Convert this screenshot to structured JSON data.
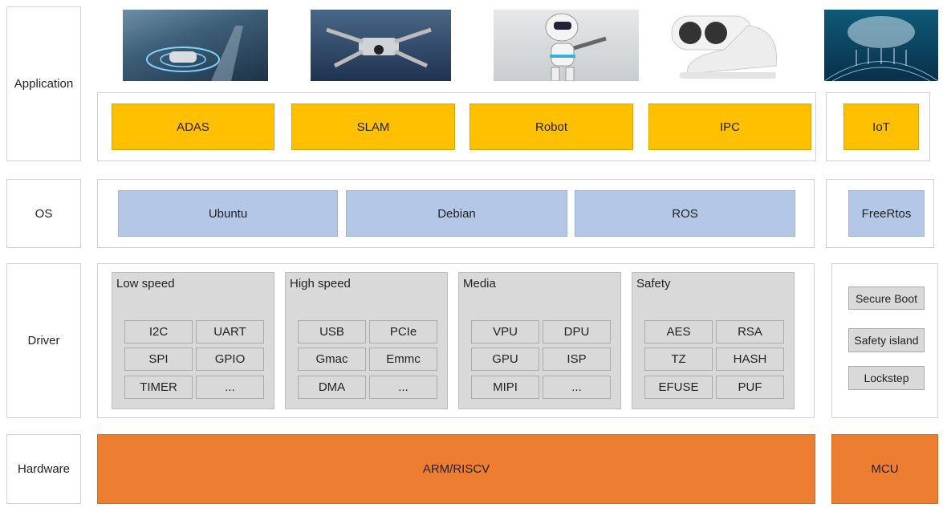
{
  "layers": {
    "application": "Application",
    "os": "OS",
    "driver": "Driver",
    "hardware": "Hardware"
  },
  "application": {
    "images": [
      "adas-car-image",
      "drone-image",
      "robot-image",
      "camera-image",
      "iot-cloud-image"
    ],
    "items": [
      "ADAS",
      "SLAM",
      "Robot",
      "IPC"
    ],
    "iot": "IoT"
  },
  "os": {
    "items": [
      "Ubuntu",
      "Debian",
      "ROS"
    ],
    "rtos": "FreeRtos"
  },
  "driver": {
    "groups": [
      {
        "title": "Low speed",
        "cells": [
          "I2C",
          "UART",
          "SPI",
          "GPIO",
          "TIMER",
          "..."
        ]
      },
      {
        "title": "High speed",
        "cells": [
          "USB",
          "PCIe",
          "Gmac",
          "Emmc",
          "DMA",
          "..."
        ]
      },
      {
        "title": "Media",
        "cells": [
          "VPU",
          "DPU",
          "GPU",
          "ISP",
          "MIPI",
          "..."
        ]
      },
      {
        "title": "Safety",
        "cells": [
          "AES",
          "RSA",
          "TZ",
          "HASH",
          "EFUSE",
          "PUF"
        ]
      }
    ],
    "mcu_items": [
      "Secure Boot",
      "Safety island",
      "Lockstep"
    ]
  },
  "hardware": {
    "main": "ARM/RISCV",
    "mcu": "MCU"
  },
  "colors": {
    "application": "#ffc000",
    "os": "#b4c7e7",
    "driver": "#d9d9d9",
    "hardware": "#ed7d31"
  }
}
